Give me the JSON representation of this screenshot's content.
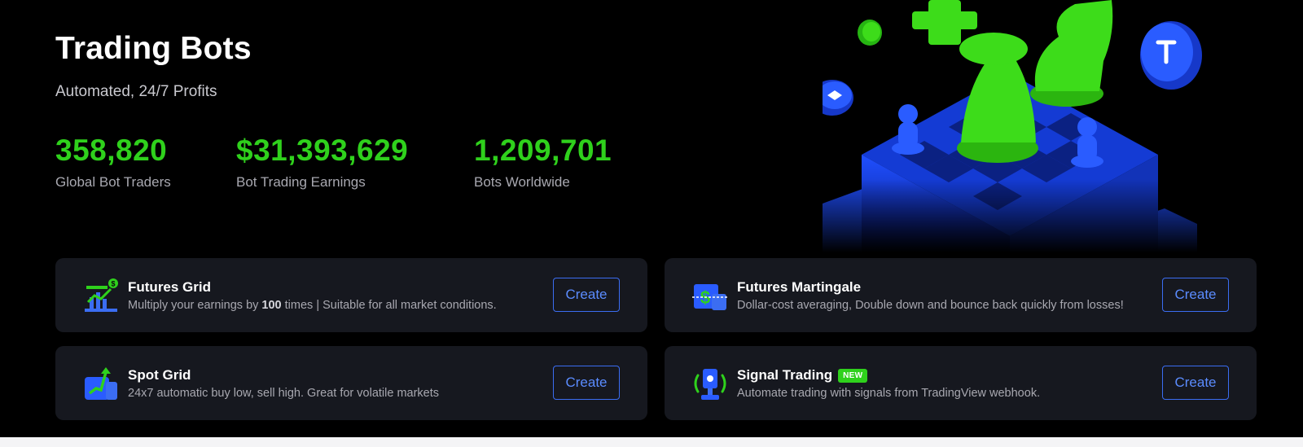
{
  "header": {
    "title": "Trading Bots",
    "subtitle": "Automated, 24/7 Profits"
  },
  "stats": [
    {
      "value": "358,820",
      "label": "Global Bot Traders"
    },
    {
      "value": "$31,393,629",
      "label": "Bot Trading Earnings"
    },
    {
      "value": "1,209,701",
      "label": "Bots Worldwide"
    }
  ],
  "bots": [
    {
      "icon": "futures-grid-icon",
      "title": "Futures Grid",
      "desc_before": "Multiply your earnings by ",
      "desc_bold": "100",
      "desc_after": " times | Suitable for all market conditions.",
      "button": "Create"
    },
    {
      "icon": "futures-martingale-icon",
      "title": "Futures Martingale",
      "desc": "Dollar-cost averaging, Double down and bounce back quickly from losses!",
      "button": "Create"
    },
    {
      "icon": "spot-grid-icon",
      "title": "Spot Grid",
      "desc": "24x7 automatic buy low, sell high. Great for volatile markets",
      "button": "Create"
    },
    {
      "icon": "signal-trading-icon",
      "title": "Signal Trading",
      "badge": "NEW",
      "desc": "Automate trading with signals from TradingView webhook.",
      "button": "Create"
    }
  ],
  "colors": {
    "accent_green": "#2fd11c",
    "accent_blue": "#3b6df2",
    "card_bg": "#16181f",
    "hero_bg": "#000000"
  }
}
